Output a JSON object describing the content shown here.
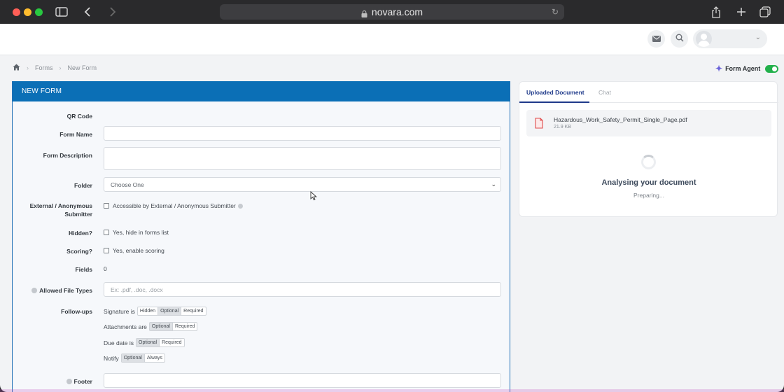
{
  "browser": {
    "url": "novara.com"
  },
  "breadcrumb": {
    "items": [
      "Forms",
      "New Form"
    ]
  },
  "agent": {
    "label": "Form Agent",
    "enabled": true
  },
  "form": {
    "header": "NEW FORM",
    "qr_label": "QR Code",
    "name_label": "Form Name",
    "name_value": "",
    "description_label": "Form Description",
    "description_value": "",
    "folder_label": "Folder",
    "folder_value": "Choose One",
    "external_label_1": "External / Anonymous",
    "external_label_2": "Submitter",
    "external_check": "Accessible by External / Anonymous Submitter",
    "hidden_label": "Hidden?",
    "hidden_check": "Yes, hide in forms list",
    "scoring_label": "Scoring?",
    "scoring_check": "Yes, enable scoring",
    "fields_label": "Fields",
    "fields_value": "0",
    "file_types_label": "Allowed File Types",
    "file_types_placeholder": "Ex: .pdf, .doc, .docx",
    "followups_label": "Follow-ups",
    "followups": [
      {
        "prefix": "Signature is",
        "options": [
          "Hidden",
          "Optional",
          "Required"
        ],
        "selected": "Optional"
      },
      {
        "prefix": "Attachments are",
        "options": [
          "Optional",
          "Required"
        ],
        "selected": "Optional"
      },
      {
        "prefix": "Due date is",
        "options": [
          "Optional",
          "Required"
        ],
        "selected": "Optional"
      },
      {
        "prefix": "Notify",
        "options": [
          "Optional",
          "Always"
        ],
        "selected": "Optional"
      }
    ],
    "footer_label": "Footer"
  },
  "panel": {
    "tabs": [
      "Uploaded Document",
      "Chat"
    ],
    "active_tab": "Uploaded Document",
    "file_name": "Hazardous_Work_Safety_Permit_Single_Page.pdf",
    "file_size": "21.9 KB",
    "status_title": "Analysing your document",
    "status_sub": "Preparing..."
  },
  "colors": {
    "accent": "#0b6fb6",
    "toggle_on": "#22b04b",
    "tab_active": "#1f3a8a"
  }
}
